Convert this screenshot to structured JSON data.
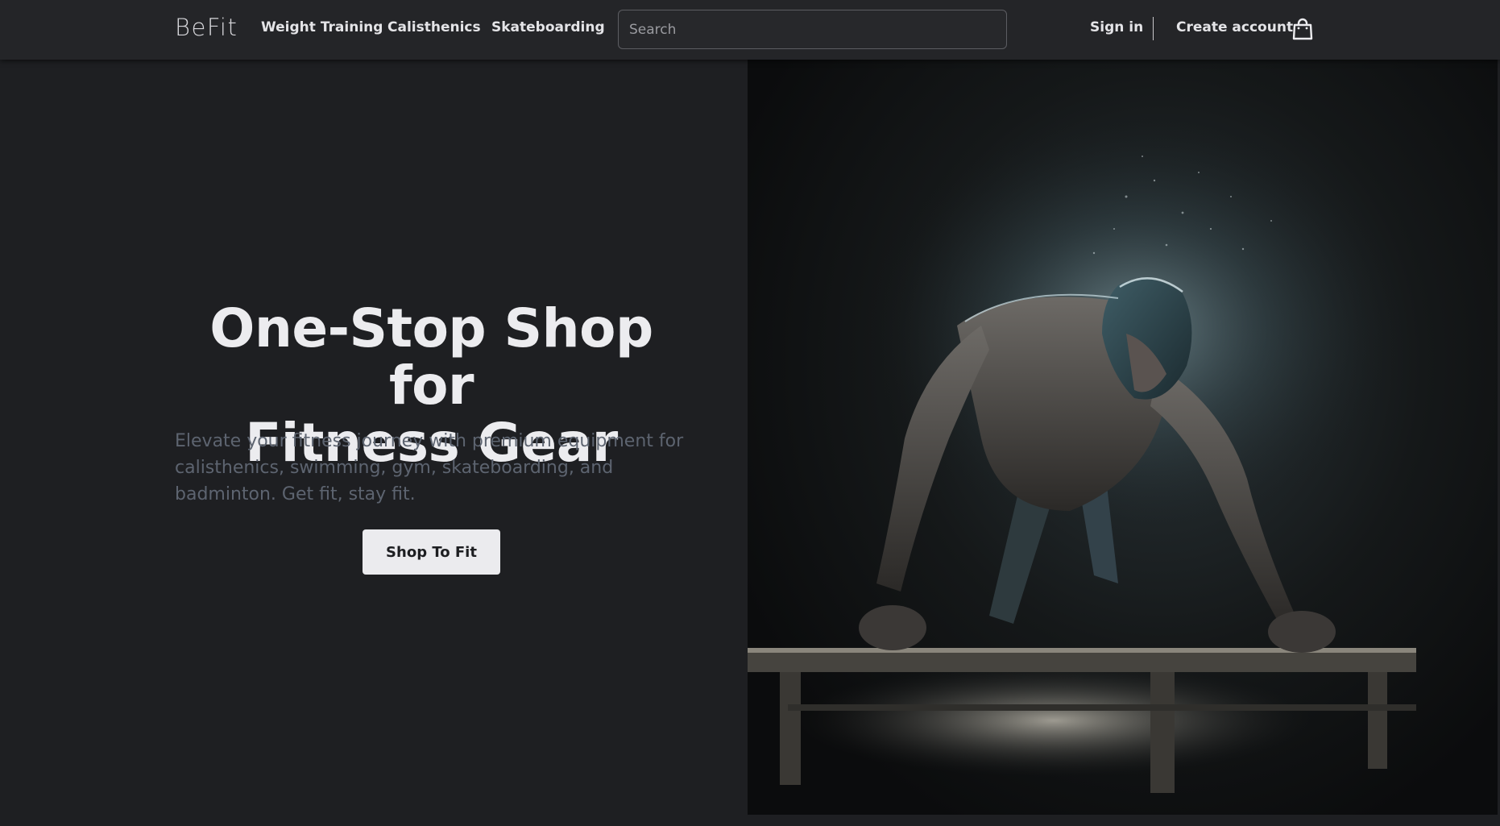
{
  "brand": {
    "name": "BeFit"
  },
  "nav": {
    "links": [
      {
        "label": "Weight Training"
      },
      {
        "label": "Calisthenics"
      },
      {
        "label": "Skateboarding"
      }
    ],
    "search": {
      "placeholder": "Search",
      "value": ""
    },
    "sign_in": "Sign in",
    "create_account": "Create account",
    "cart_icon": "shopping-bag-icon"
  },
  "hero": {
    "title_line1": "One-Stop Shop for",
    "title_line2": "Fitness Gear",
    "subtitle": "Elevate your fitness journey with premium equipment for calisthenics, swimming, gym, skateboarding, and badminton. Get fit, stay fit.",
    "cta_label": "Shop To Fit",
    "image_subject": "athlete-doing-pushup-on-bar-illustration"
  },
  "colors": {
    "background": "#1e1f22",
    "navbar": "#242528",
    "cta_background": "#ebebee",
    "subtitle": "#5d6470"
  }
}
